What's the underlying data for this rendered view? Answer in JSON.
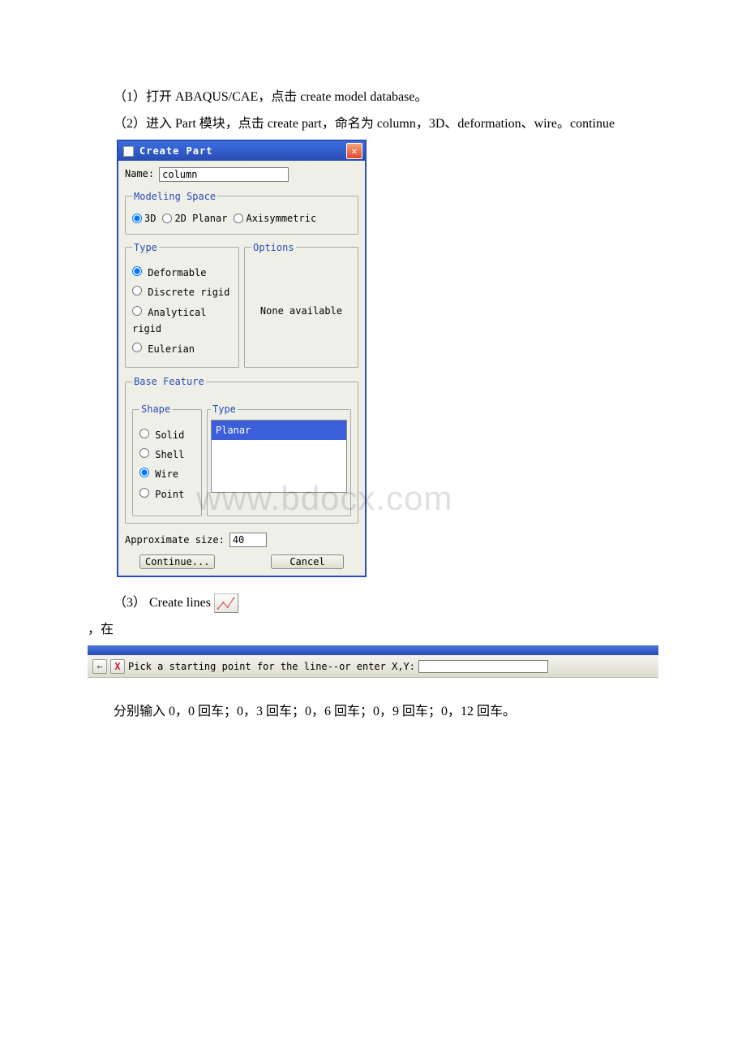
{
  "paragraphs": {
    "p1": "（1）打开 ABAQUS/CAE，点击 create model database。",
    "p2": "（2）进入 Part 模块，点击 create part，命名为 column，3D、deformation、wire。continue",
    "p3_prefix": "（3） Create lines",
    "p4": "，在",
    "p5": "分别输入 0，0 回车；0，3 回车；0，6 回车；0，9 回车；0，12 回车。"
  },
  "dialog": {
    "title": "Create Part",
    "name_label": "Name:",
    "name_value": "column",
    "modeling_space": {
      "legend": "Modeling Space",
      "options": {
        "3d": "3D",
        "planar": "2D Planar",
        "axi": "Axisymmetric"
      },
      "selected": "3d"
    },
    "type": {
      "legend": "Type",
      "options": {
        "deformable": "Deformable",
        "discrete": "Discrete rigid",
        "analytical": "Analytical rigid",
        "eulerian": "Eulerian"
      },
      "selected": "deformable"
    },
    "options_panel": {
      "legend": "Options",
      "text": "None available"
    },
    "base_feature": {
      "legend": "Base Feature",
      "shape": {
        "legend": "Shape",
        "options": {
          "solid": "Solid",
          "shell": "Shell",
          "wire": "Wire",
          "point": "Point"
        },
        "selected": "wire"
      },
      "type_list": {
        "legend": "Type",
        "items": [
          "Planar"
        ],
        "selected": 0
      }
    },
    "approx_label": "Approximate size:",
    "approx_value": "40",
    "continue_btn": "Continue...",
    "cancel_btn": "Cancel"
  },
  "prompt_bar": {
    "text": "Pick a starting point for the line--or enter X,Y:",
    "input_value": ""
  },
  "watermark": "www.bdocx.com"
}
